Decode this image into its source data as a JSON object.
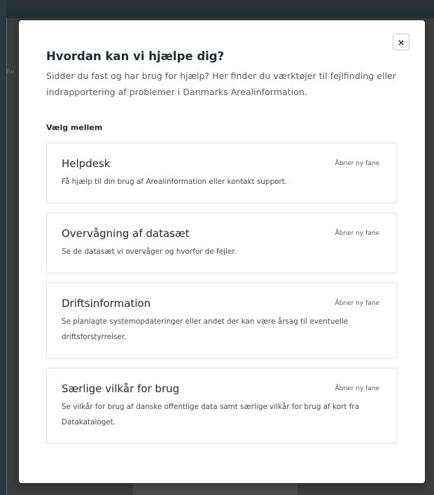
{
  "background": {
    "stub_text": "Re"
  },
  "modal": {
    "close_label": "×",
    "title": "Hvordan kan vi hjælpe dig?",
    "intro": "Sidder du fast og har brug for hjælp? Her finder du værktøjer til fejlfinding eller indrapportering af problemer i Danmarks Arealinformation.",
    "choose_label": "Vælg mellem",
    "cards": [
      {
        "title": "Helpdesk",
        "badge": "Åbner ny fane",
        "description": "Få hjælp til din brug af Arealinformation eller kontakt support."
      },
      {
        "title": "Overvågning af datasæt",
        "badge": "Åbner ny fane",
        "description": "Se de datasæt vi overvåger og hvorfor de fejler."
      },
      {
        "title": "Driftsinformation",
        "badge": "Åbner ny fane",
        "description": "Se planlagte systemopdateringer eller andet der kan være årsag til eventuelle driftsforstyrrelser."
      },
      {
        "title": "Særlige vilkår for brug",
        "badge": "Åbner ny fane",
        "description": "Se vilkår for brug af danske offentlige data samt særlige vilkår for brug af kort fra Datakataloget."
      }
    ]
  },
  "colors": {
    "overlay": "#3a3a3a",
    "text_primary": "#1f2a33",
    "text_secondary": "#555c62",
    "card_border": "#e2e2e2"
  }
}
